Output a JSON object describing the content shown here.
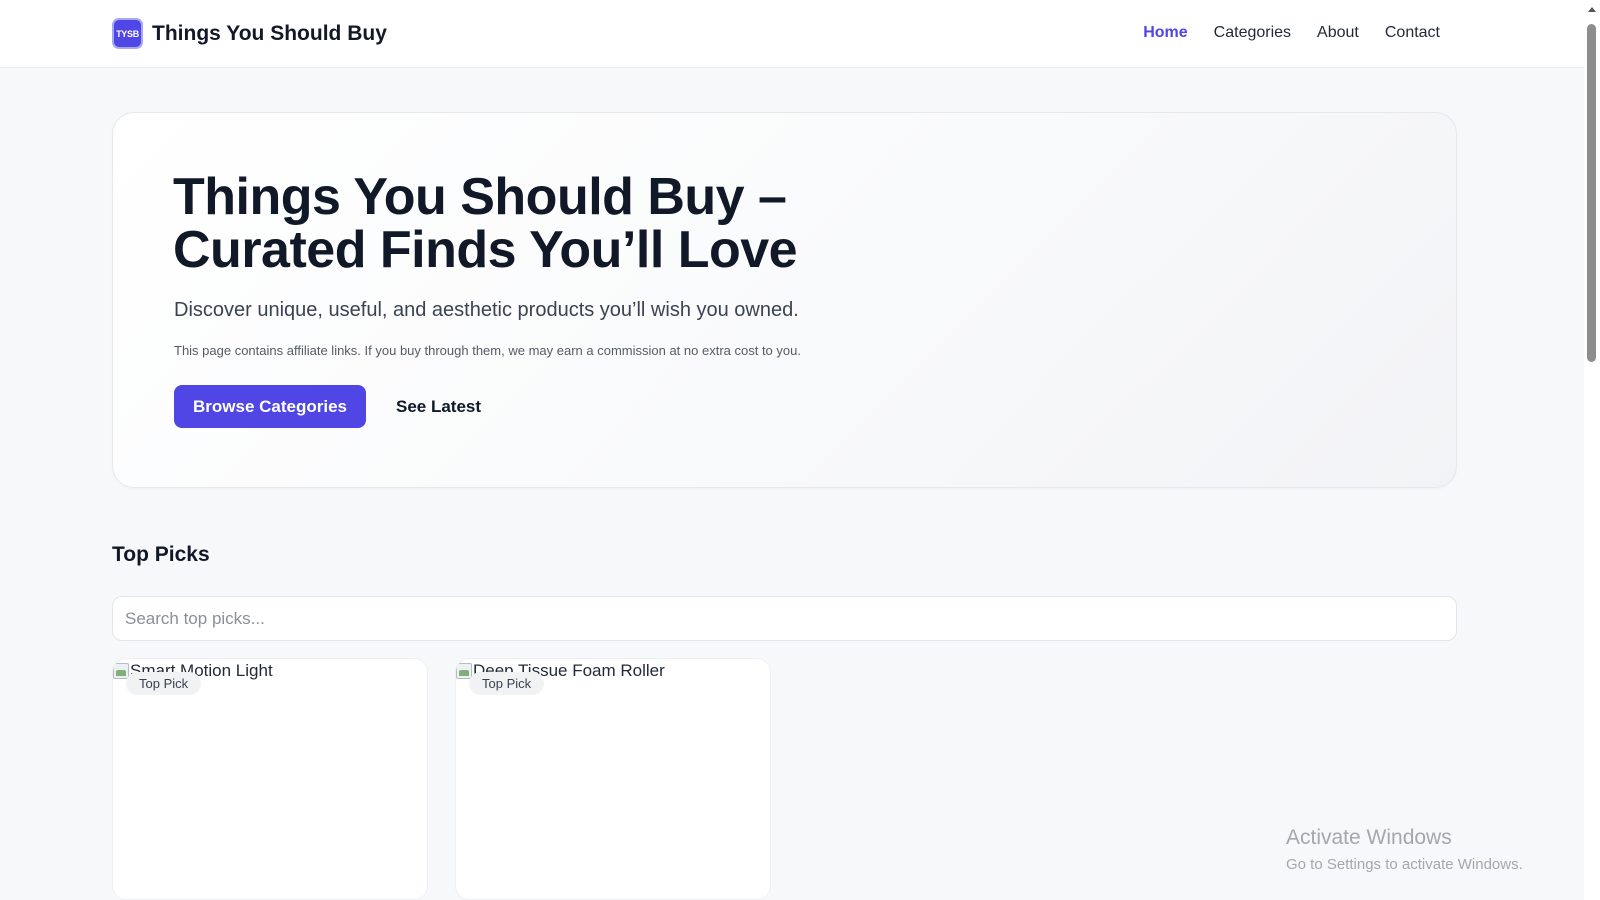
{
  "header": {
    "logo_text": "TYSB",
    "site_name": "Things You Should Buy",
    "nav": {
      "home": "Home",
      "categories": "Categories",
      "about": "About",
      "contact": "Contact"
    },
    "active_nav": "Home",
    "accent_color": "#4f46e5"
  },
  "hero": {
    "title": "Things You Should Buy – Curated Finds You’ll Love",
    "subtitle": "Discover unique, useful, and aesthetic products you’ll wish you owned.",
    "disclaimer": "This page contains affiliate links. If you buy through them, we may earn a commission at no extra cost to you.",
    "primary_button": "Browse Categories",
    "secondary_button": "See Latest"
  },
  "top_picks": {
    "title": "Top Picks",
    "search_placeholder": "Search top picks...",
    "search_value": "",
    "cards": [
      {
        "image_alt": "Smart Motion Light",
        "badge": "Top Pick"
      },
      {
        "image_alt": "Deep Tissue Foam Roller",
        "badge": "Top Pick"
      }
    ]
  },
  "watermark": {
    "title": "Activate Windows",
    "subtitle": "Go to Settings to activate Windows."
  }
}
